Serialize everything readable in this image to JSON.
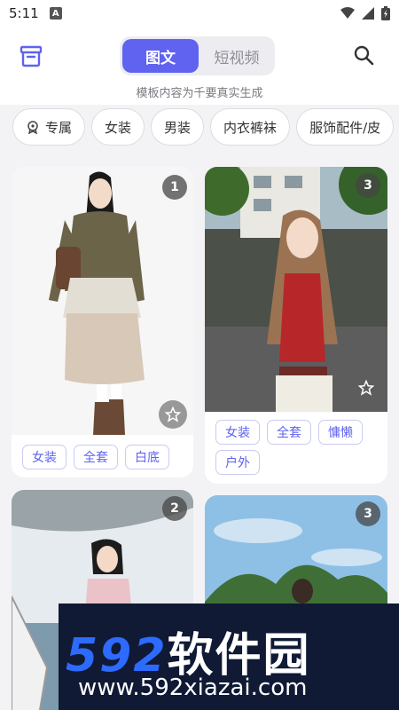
{
  "status": {
    "time": "5:11",
    "notif_letter": "A"
  },
  "header": {
    "tab_active": "图文",
    "tab_inactive": "短视频",
    "disclaimer": "模板内容为千要真实生成"
  },
  "chips": [
    "专属",
    "女装",
    "男装",
    "内衣裤袜",
    "服饰配件/皮"
  ],
  "cards": [
    {
      "badge": "1",
      "tags": [
        "女装",
        "全套",
        "白底"
      ]
    },
    {
      "badge": "3",
      "tags": [
        "女装",
        "全套",
        "慵懒",
        "户外"
      ]
    },
    {
      "badge": "2"
    },
    {
      "badge": "3"
    }
  ],
  "watermark": {
    "number": "592",
    "brand": "软件园",
    "url": "www.592xiazai.com"
  },
  "colors": {
    "accent": "#5f63f0",
    "chip_border": "#dcdce2",
    "background": "#f3f3f5"
  }
}
